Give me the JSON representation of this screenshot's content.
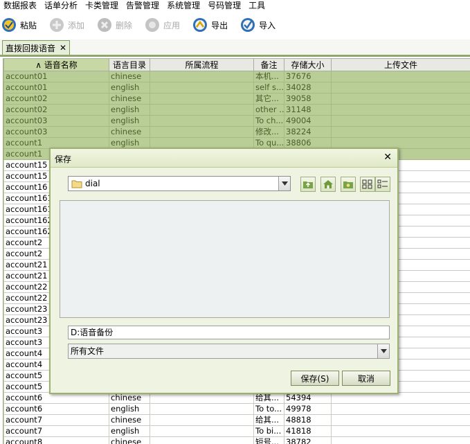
{
  "menu": [
    "数据报表",
    "话单分析",
    "卡类管理",
    "告警管理",
    "系统管理",
    "号码管理",
    "工具"
  ],
  "toolbar": {
    "paste": "粘贴",
    "add": "添加",
    "delete": "删除",
    "apply": "应用",
    "export": "导出",
    "import": "导入"
  },
  "tab": {
    "label": "直拨回拨语音",
    "close": "✕"
  },
  "table": {
    "headers": [
      "∧ 语音名称",
      "语言目录",
      "所属流程",
      "备注",
      "存储大小",
      "上传文件"
    ],
    "rows": [
      [
        "account01",
        "chinese",
        "",
        "本机...",
        "37676",
        ""
      ],
      [
        "account01",
        "english",
        "",
        "self s...",
        "34028",
        ""
      ],
      [
        "account02",
        "chinese",
        "",
        "其它...",
        "39058",
        ""
      ],
      [
        "account02",
        "english",
        "",
        "other ...",
        "31148",
        ""
      ],
      [
        "account03",
        "english",
        "",
        "To ch...",
        "49004",
        ""
      ],
      [
        "account03",
        "chinese",
        "",
        "修改...",
        "38224",
        ""
      ],
      [
        "account1",
        "english",
        "",
        "To qu...",
        "38806",
        ""
      ],
      [
        "account1",
        "",
        "",
        "",
        "",
        ""
      ],
      [
        "account15",
        "",
        "",
        "",
        "",
        ""
      ],
      [
        "account15",
        "",
        "",
        "",
        "",
        ""
      ],
      [
        "account16",
        "",
        "",
        "",
        "",
        ""
      ],
      [
        "account161",
        "",
        "",
        "",
        "",
        ""
      ],
      [
        "account161",
        "",
        "",
        "",
        "",
        ""
      ],
      [
        "account162",
        "",
        "",
        "",
        "",
        ""
      ],
      [
        "account162",
        "",
        "",
        "",
        "",
        ""
      ],
      [
        "account2",
        "",
        "",
        "",
        "",
        ""
      ],
      [
        "account2",
        "",
        "",
        "",
        "",
        ""
      ],
      [
        "account21",
        "",
        "",
        "",
        "",
        ""
      ],
      [
        "account21",
        "",
        "",
        "",
        "",
        ""
      ],
      [
        "account22",
        "",
        "",
        "",
        "",
        ""
      ],
      [
        "account22",
        "",
        "",
        "",
        "",
        ""
      ],
      [
        "account23",
        "",
        "",
        "",
        "",
        ""
      ],
      [
        "account23",
        "",
        "",
        "",
        "",
        ""
      ],
      [
        "account3",
        "",
        "",
        "",
        "",
        ""
      ],
      [
        "account3",
        "",
        "",
        "",
        "",
        ""
      ],
      [
        "account4",
        "",
        "",
        "",
        "",
        ""
      ],
      [
        "account4",
        "",
        "",
        "",
        "",
        ""
      ],
      [
        "account5",
        "",
        "",
        "",
        "",
        ""
      ],
      [
        "account5",
        "",
        "",
        "",
        "",
        ""
      ],
      [
        "account6",
        "chinese",
        "",
        "给其...",
        "54394",
        ""
      ],
      [
        "account6",
        "english",
        "",
        "To to...",
        "49978",
        ""
      ],
      [
        "account7",
        "chinese",
        "",
        "给其...",
        "48818",
        ""
      ],
      [
        "account7",
        "english",
        "",
        "To bi...",
        "41818",
        ""
      ],
      [
        "account8",
        "chinese",
        "",
        "短号...",
        "38782",
        ""
      ]
    ],
    "selected_count": 8
  },
  "dialog": {
    "title": "保存",
    "close": "✕",
    "directory": "dial",
    "filename": "D:语音备份",
    "filetype": "所有文件",
    "save_label": "保存(S)",
    "cancel_label": "取消"
  },
  "colors": {
    "accent": "#8fa66d",
    "selection": "#b9cd97",
    "dialog_bg": "#eef3e2"
  }
}
